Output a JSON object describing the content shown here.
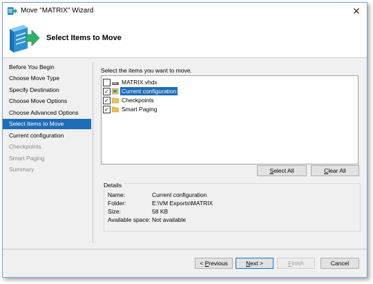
{
  "window": {
    "title": "Move \"MATRIX\" Wizard",
    "close_glyph": "✕"
  },
  "header": {
    "title": "Select Items to Move",
    "icon": "server-arrow-icon"
  },
  "nav": {
    "items": [
      {
        "label": "Before You Begin",
        "state": "normal"
      },
      {
        "label": "Choose Move Type",
        "state": "normal"
      },
      {
        "label": "Specify Destination",
        "state": "normal"
      },
      {
        "label": "Choose Move Options",
        "state": "normal"
      },
      {
        "label": "Choose Advanced Options",
        "state": "normal"
      },
      {
        "label": "Select Items to Move",
        "state": "selected"
      },
      {
        "label": "Current configuration",
        "state": "normal"
      },
      {
        "label": "Checkpoints",
        "state": "disabled"
      },
      {
        "label": "Smart Paging",
        "state": "disabled"
      },
      {
        "label": "Summary",
        "state": "disabled"
      }
    ]
  },
  "main": {
    "instruction": "Select the items you want to move.",
    "items": [
      {
        "label": "MATRIX.vhdx",
        "checked": false,
        "icon": "disk-icon"
      },
      {
        "label": "Current configuration",
        "checked": true,
        "icon": "config-icon",
        "highlighted": true
      },
      {
        "label": "Checkpoints",
        "checked": true,
        "icon": "folder-icon"
      },
      {
        "label": "Smart Paging",
        "checked": true,
        "icon": "folder-icon"
      }
    ],
    "check_glyph": "✓",
    "select_all": {
      "prefix": "",
      "accel": "S",
      "suffix": "elect All"
    },
    "clear_all": {
      "prefix": "",
      "accel": "C",
      "suffix": "lear All"
    }
  },
  "details": {
    "title": "Details",
    "rows": [
      {
        "label": "Name:",
        "value": "Current configuration"
      },
      {
        "label": "Folder:",
        "value": "E:\\VM Exports\\MATRIX"
      },
      {
        "label": "Size:",
        "value": "58 KB"
      },
      {
        "label": "Available space:",
        "value": "Not available"
      }
    ]
  },
  "footer": {
    "previous": {
      "prefix": "< ",
      "accel": "P",
      "suffix": "revious"
    },
    "next": {
      "prefix": "",
      "accel": "N",
      "suffix": "ext >"
    },
    "finish": {
      "prefix": "",
      "accel": "F",
      "suffix": "inish"
    },
    "cancel": "Cancel"
  },
  "colors": {
    "selection": "#1f6cb8",
    "window_border": "#7a9ec6",
    "background": "#f0f0f0"
  }
}
